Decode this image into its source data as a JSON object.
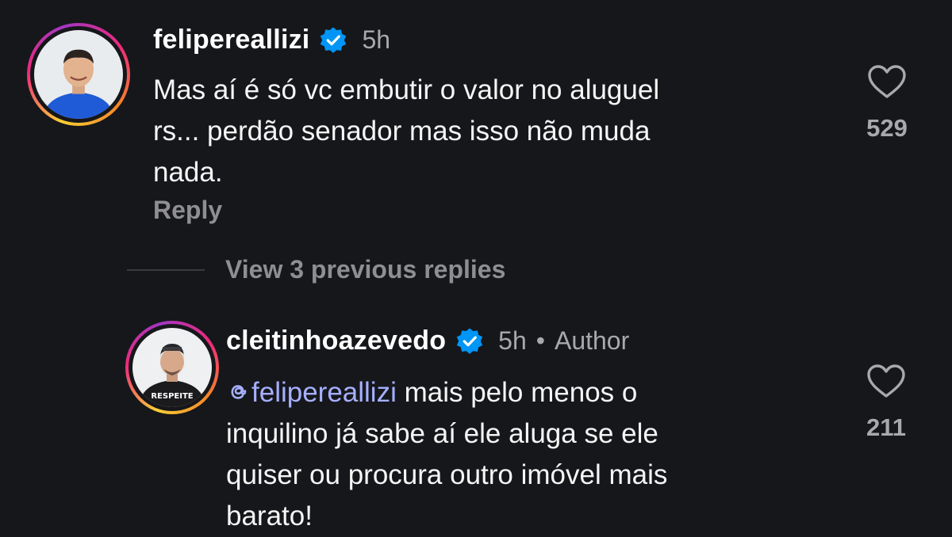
{
  "comments": [
    {
      "username": "felipereallizi",
      "time": "5h",
      "text_lines": [
        "Mas aí é só vc embutir o valor no aluguel",
        "rs... perdão senador mas isso não muda",
        "nada."
      ],
      "reply_label": "Reply",
      "likes": "529"
    },
    {
      "username": "cleitinhoazevedo",
      "time": "5h",
      "separator": "•",
      "author_label": "Author",
      "mention_icon": "threads-at-icon",
      "mention": "felipereallizi",
      "text_first_line_rest": " mais pelo menos o",
      "text_lines": [
        "inquilino já sabe aí ele aluga se ele",
        "quiser ou procura outro imóvel mais",
        "barato!"
      ],
      "avatar_shirt_text": "RESPEITE",
      "likes": "211"
    }
  ],
  "view_previous_replies": "View 3 previous replies",
  "colors": {
    "background": "#16171b",
    "mention": "#a6b0ff",
    "verified_badge": "#0095f6",
    "secondary_text": "#a8a8ad"
  }
}
